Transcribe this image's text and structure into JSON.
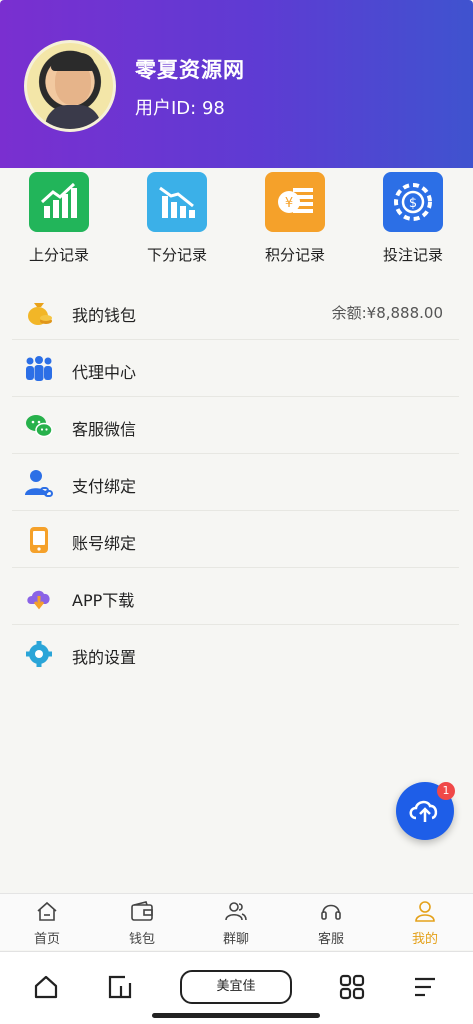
{
  "header": {
    "site_name": "零夏资源网",
    "user_id": "用户ID: 98"
  },
  "quick_actions": [
    {
      "label": "上分记录",
      "icon": "chart-up-icon",
      "color": "#22b55a"
    },
    {
      "label": "下分记录",
      "icon": "chart-down-icon",
      "color": "#3bb0e8"
    },
    {
      "label": "积分记录",
      "icon": "coin-stack-icon",
      "color": "#f5a12a"
    },
    {
      "label": "投注记录",
      "icon": "chip-icon",
      "color": "#2c6fe6"
    }
  ],
  "menu": [
    {
      "label": "我的钱包",
      "icon": "money-bag-icon",
      "right": "余额:¥8,888.00"
    },
    {
      "label": "代理中心",
      "icon": "team-icon",
      "right": ""
    },
    {
      "label": "客服微信",
      "icon": "wechat-icon",
      "right": ""
    },
    {
      "label": "支付绑定",
      "icon": "user-link-icon",
      "right": ""
    },
    {
      "label": "账号绑定",
      "icon": "phone-icon",
      "right": ""
    },
    {
      "label": "APP下载",
      "icon": "cloud-download-icon",
      "right": ""
    },
    {
      "label": "我的设置",
      "icon": "gear-icon",
      "right": ""
    }
  ],
  "fab": {
    "badge": "1",
    "icon": "cloud-upload-icon"
  },
  "tabbar": [
    {
      "label": "首页",
      "icon": "home-icon"
    },
    {
      "label": "钱包",
      "icon": "wallet-icon"
    },
    {
      "label": "群聊",
      "icon": "people-icon"
    },
    {
      "label": "客服",
      "icon": "headset-icon"
    },
    {
      "label": "我的",
      "icon": "user-icon"
    }
  ],
  "active_tab": "我的",
  "navbar": {
    "pill_label": "美宜佳"
  },
  "colors": {
    "accent": "#e4a11b",
    "header_start": "#7a2fd0",
    "header_end": "#3f53cf",
    "fab": "#1e5ee8"
  }
}
